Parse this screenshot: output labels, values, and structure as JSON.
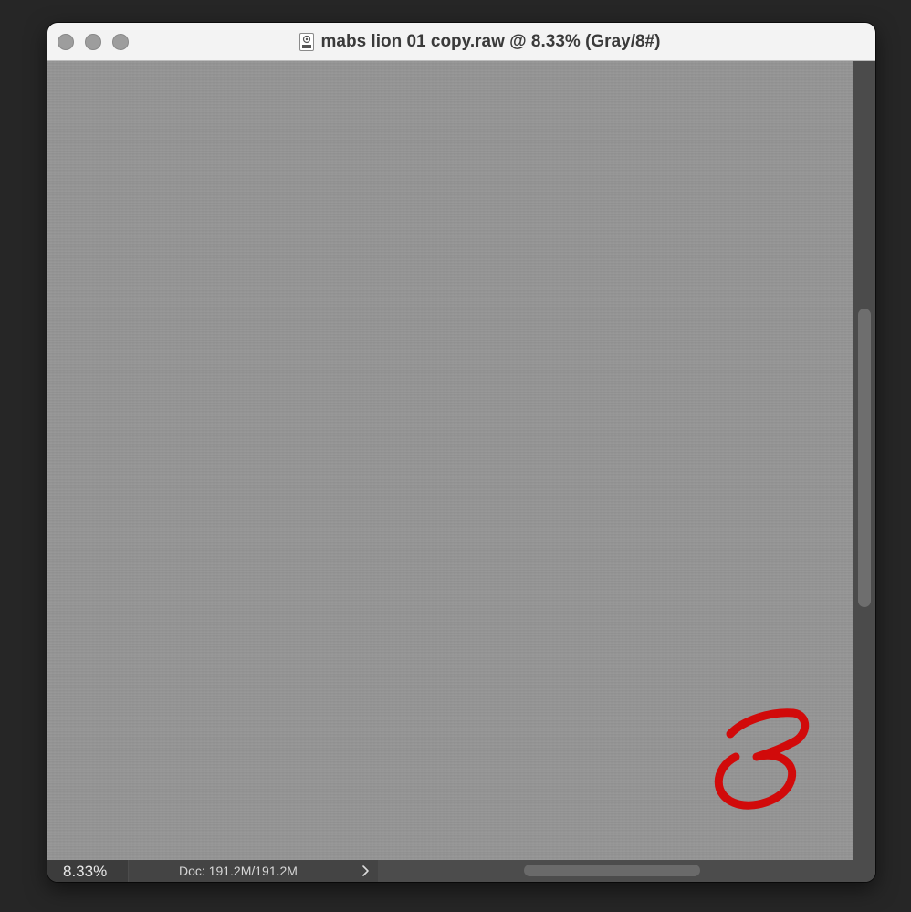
{
  "window": {
    "title": "mabs lion 01 copy.raw @ 8.33% (Gray/8#)",
    "file_icon": "raw-file-icon"
  },
  "status": {
    "zoom": "8.33%",
    "doc_info": "Doc: 191.2M/191.2M"
  },
  "annotation": {
    "label": "3",
    "color": "#d10a0a"
  },
  "scroll": {
    "vertical_thumb_position": 0.31,
    "vertical_thumb_fraction": 0.37,
    "horizontal_thumb_position": 0.31,
    "horizontal_thumb_fraction": 0.37
  },
  "colors": {
    "canvas": "#959595",
    "titlebar": "#f3f3f3",
    "status_bar": "#4c4c4c"
  }
}
